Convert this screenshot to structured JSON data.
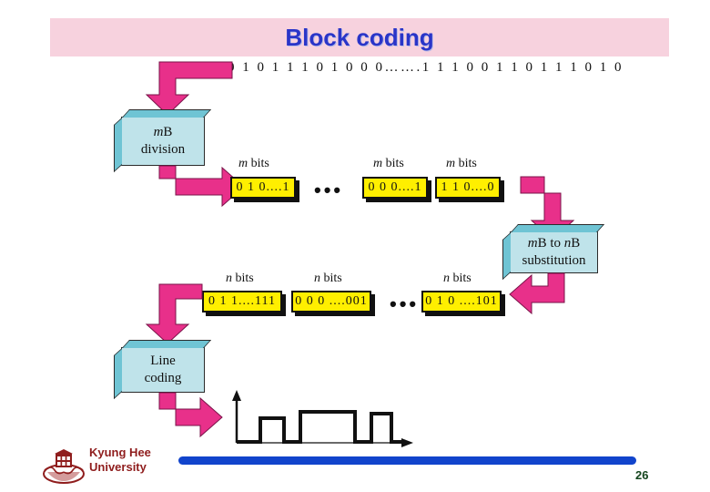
{
  "slide": {
    "title": "Block coding",
    "page_number": "26",
    "title_band_color": "#f7d2de",
    "title_text_color": "#2a35c8",
    "arrow_color": "#e8308a",
    "process_box_color": "#bfe3ea",
    "chip_color": "#ffef00",
    "footer_bar_color": "#1144cc"
  },
  "bitstream": {
    "value": "0 1 0 1 1 1 0 1 0 0 0…….1 1 1 0 0 1 1 0 1 1 1 0 1 0"
  },
  "process_boxes": {
    "division": {
      "line1_italic": "m",
      "line1_rest": "B",
      "line2": "division"
    },
    "substitution": {
      "line1_a_italic": "m",
      "line1_a_rest": "B to ",
      "line1_b_italic": "n",
      "line1_b_rest": "B",
      "line2": "substitution"
    },
    "line_coding": {
      "line1": "Line",
      "line2": "coding"
    }
  },
  "m_row": {
    "label_italic": "m",
    "label_rest": " bits",
    "ellipsis": "•••",
    "chips": [
      {
        "value": "0 1 0....1"
      },
      {
        "value": "0 0 0....1"
      },
      {
        "value": "1 1 0....0"
      }
    ]
  },
  "n_row": {
    "label_italic": "n",
    "label_rest": " bits",
    "ellipsis": "•••",
    "chips": [
      {
        "value": "0 1 1....111"
      },
      {
        "value": "0 0 0 ....001"
      },
      {
        "value": "0 1 0 ....101"
      }
    ]
  },
  "waveform": {
    "description": "digital-signal-waveform",
    "levels": [
      0,
      1,
      0,
      1,
      0,
      1,
      0
    ]
  },
  "footer": {
    "university_line1": "Kyung Hee",
    "university_line2": "University",
    "logo_name": "kyung-hee-university-emblem"
  }
}
